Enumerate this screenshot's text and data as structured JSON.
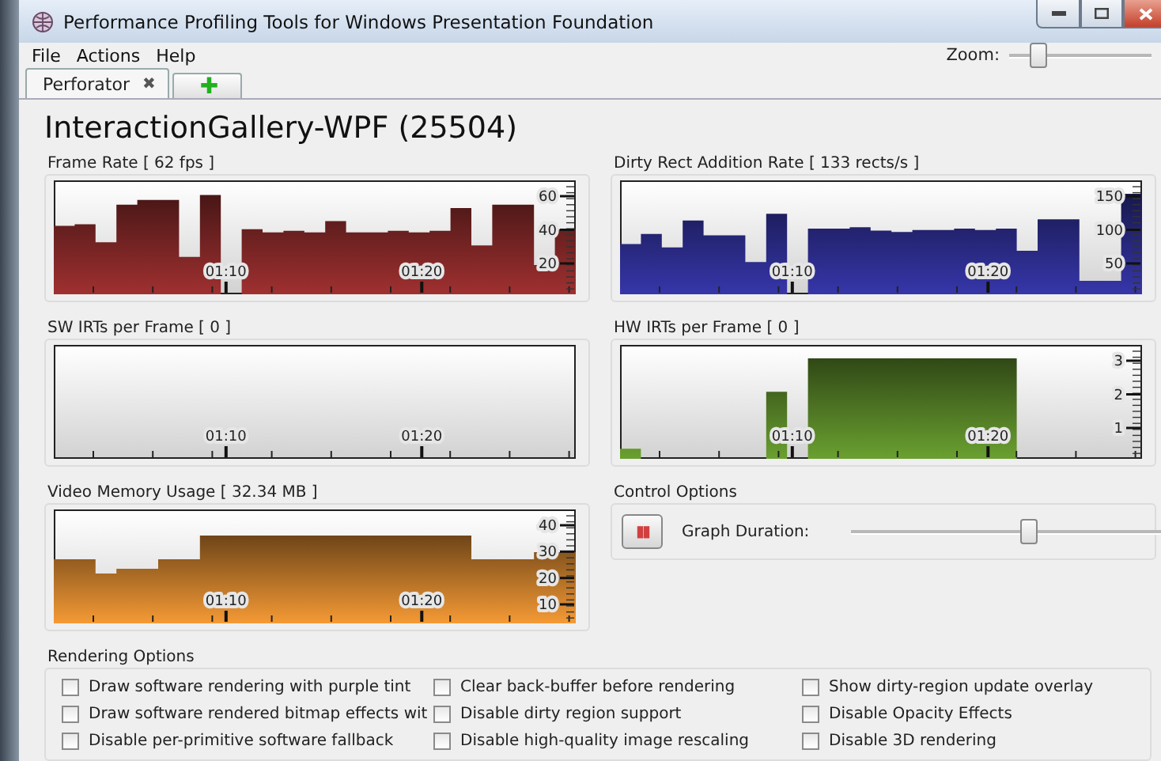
{
  "window": {
    "title": "Performance Profiling Tools for Windows Presentation Foundation"
  },
  "menu": [
    "File",
    "Actions",
    "Help"
  ],
  "zoom": {
    "label": "Zoom:",
    "level": 0.2
  },
  "tabs": [
    {
      "label": "Perforator",
      "close": "✖",
      "selected": true
    },
    {
      "label": "✚",
      "kind": "add",
      "selected": false
    }
  ],
  "process_title": "InteractionGallery-WPF (25504)",
  "graphs": [
    {
      "title": "Frame Rate [ 62 fps ]",
      "color": "#a03030",
      "x_labels": [
        "01:10",
        "01:20"
      ],
      "y_labels": [
        "60",
        "40",
        "20"
      ]
    },
    {
      "title": "Dirty Rect Addition Rate [ 133 rects/s ]",
      "color": "#3636aa",
      "x_labels": [
        "01:10",
        "01:20"
      ],
      "y_labels": [
        "150",
        "100",
        "50"
      ]
    },
    {
      "title": "SW IRTs per Frame [ 0 ]",
      "x_labels": [
        "01:10",
        "01:20"
      ]
    },
    {
      "title": "HW IRTs per Frame [ 0 ]",
      "color": "#6aa030",
      "x_labels": [
        "01:10",
        "01:20"
      ],
      "y_labels": [
        "3",
        "2",
        "1"
      ]
    },
    {
      "title": "Video Memory Usage [ 32.34 MB ]",
      "color": "#f59a35",
      "x_labels": [
        "01:10",
        "01:20"
      ],
      "y_labels": [
        "40",
        "30",
        "20",
        "10"
      ]
    }
  ],
  "control_options": {
    "title": "Control Options",
    "pause_button": "▮▮",
    "duration_label": "Graph Duration:",
    "duration": {
      "level": 0.55
    }
  },
  "rendering_options": {
    "title": "Rendering Options",
    "options": [
      {
        "label": "Draw software rendering with purple tint",
        "checked": false
      },
      {
        "label": "Clear back-buffer before rendering",
        "checked": false
      },
      {
        "label": "Show dirty-region update overlay",
        "checked": false
      },
      {
        "label": "Draw software rendered bitmap effects wit",
        "checked": false
      },
      {
        "label": "Disable dirty region support",
        "checked": false
      },
      {
        "label": "Disable Opacity Effects",
        "checked": false
      },
      {
        "label": "Disable per-primitive software fallback",
        "checked": false
      },
      {
        "label": "Disable high-quality image rescaling",
        "checked": false
      },
      {
        "label": "Disable 3D rendering",
        "checked": false
      }
    ]
  }
}
